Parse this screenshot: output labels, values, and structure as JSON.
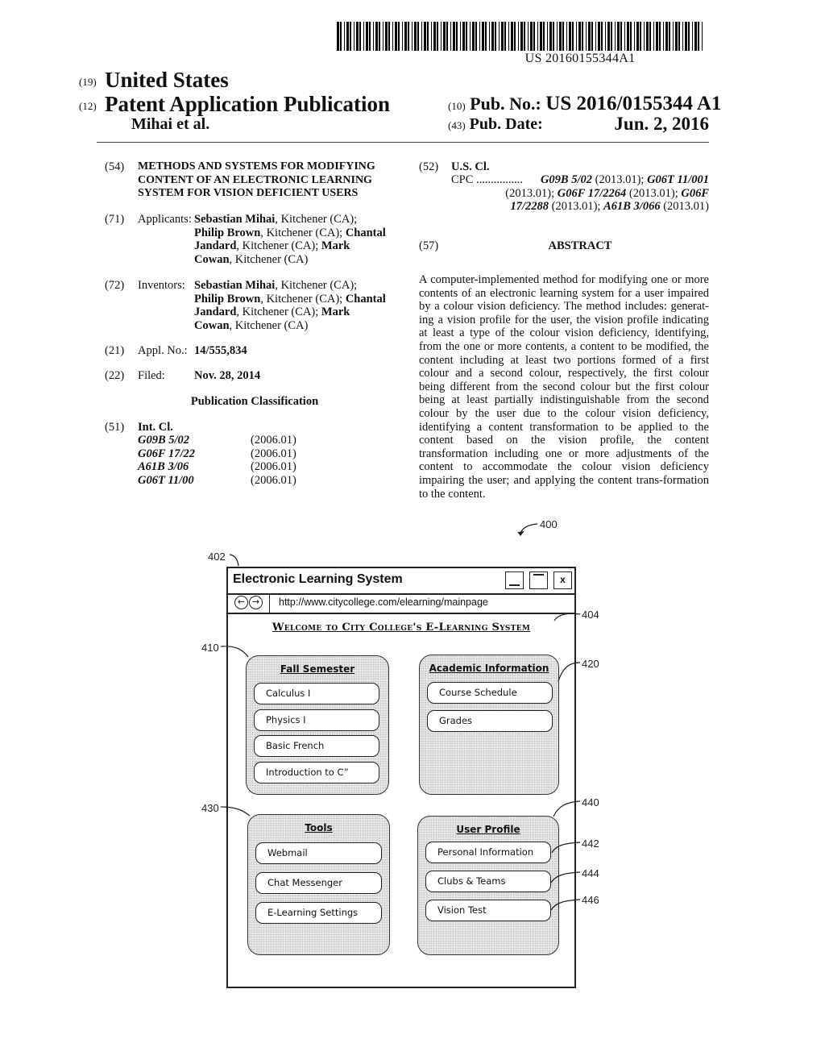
{
  "barcode": {
    "number": "US 20160155344A1"
  },
  "header": {
    "code_country": "(19)",
    "country": "United States",
    "code_type": "(12)",
    "doc_type": "Patent Application Publication",
    "authors": "Mihai et al.",
    "code_pubno": "(10)",
    "pubno_label": "Pub. No.:",
    "pubno_value": "US 2016/0155344 A1",
    "code_pubdate": "(43)",
    "pubdate_label": "Pub. Date:",
    "pubdate_value": "Jun. 2, 2016"
  },
  "left": {
    "title": {
      "code": "(54)",
      "text": "METHODS AND SYSTEMS FOR MODIFYING CONTENT OF AN ELECTRONIC LEARNING SYSTEM FOR VISION DEFICIENT USERS"
    },
    "applicants": {
      "code": "(71)",
      "label": "Applicants:",
      "lines": [
        [
          {
            "b": "Sebastian Mihai"
          },
          {
            "t": ", Kitchener (CA);"
          }
        ],
        [
          {
            "b": "Philip Brown"
          },
          {
            "t": ", Kitchener (CA); "
          },
          {
            "b": "Chantal"
          }
        ],
        [
          {
            "b": "Jandard"
          },
          {
            "t": ", Kitchener (CA); "
          },
          {
            "b": "Mark"
          }
        ],
        [
          {
            "b": "Cowan"
          },
          {
            "t": ", Kitchener (CA)"
          }
        ]
      ]
    },
    "inventors": {
      "code": "(72)",
      "label": "Inventors:",
      "lines": [
        [
          {
            "b": "Sebastian Mihai"
          },
          {
            "t": ", Kitchener (CA);"
          }
        ],
        [
          {
            "b": "Philip Brown"
          },
          {
            "t": ", Kitchener (CA); "
          },
          {
            "b": "Chantal"
          }
        ],
        [
          {
            "b": "Jandard"
          },
          {
            "t": ", Kitchener (CA); "
          },
          {
            "b": "Mark"
          }
        ],
        [
          {
            "b": "Cowan"
          },
          {
            "t": ", Kitchener (CA)"
          }
        ]
      ]
    },
    "appl": {
      "code": "(21)",
      "label": "Appl. No.:",
      "value": "14/555,834"
    },
    "filed": {
      "code": "(22)",
      "label": "Filed:",
      "value": "Nov. 28, 2014"
    },
    "pub_class_heading": "Publication Classification",
    "int_cl": {
      "code": "(51)",
      "label": "Int. Cl.",
      "rows": [
        {
          "class": "G09B 5/02",
          "version": "(2006.01)"
        },
        {
          "class": "G06F 17/22",
          "version": "(2006.01)"
        },
        {
          "class": "A61B 3/06",
          "version": "(2006.01)"
        },
        {
          "class": "G06T 11/00",
          "version": "(2006.01)"
        }
      ]
    }
  },
  "right": {
    "us_cl": {
      "code": "(52)",
      "label": "U.S. Cl.",
      "cpc_label": "CPC",
      "cpc_dots": "................",
      "lines": [
        [
          {
            "i": "G09B 5/02"
          },
          {
            "t": " (2013.01); "
          },
          {
            "i": "G06T 11/001"
          }
        ],
        [
          {
            "t": "(2013.01); "
          },
          {
            "i": "G06F 17/2264"
          },
          {
            "t": " (2013.01); "
          },
          {
            "i": "G06F"
          }
        ],
        [
          {
            "i": "17/2288"
          },
          {
            "t": " (2013.01); "
          },
          {
            "i": "A61B 3/066"
          },
          {
            "t": " (2013.01)"
          }
        ]
      ]
    },
    "abstract": {
      "code": "(57)",
      "heading": "ABSTRACT",
      "text": "A computer-implemented method for modifying one or more contents of an electronic learning system for a user impaired by a colour vision deficiency. The method includes: generat-ing a vision profile for the user, the vision profile indicating at least a type of the colour vision deficiency, identifying, from the one or more contents, a content to be modified, the content including at least two portions formed of a first colour and a second colour, respectively, the first colour being different from the second colour but the first colour being at least partially indistinguishable from the second colour by the user due to the colour vision deficiency, identifying a content transformation to be applied to the content based on the vision profile, the content transformation including one or more adjustments of the content to accommodate the colour vision deficiency impairing the user; and applying the content trans-formation to the content."
    }
  },
  "figure": {
    "refs": {
      "fig": "400",
      "window": "402",
      "welcome": "404",
      "panel1": "410",
      "panel2": "420",
      "panel3": "430",
      "panel4": "440",
      "item_personal": "442",
      "item_clubs": "444",
      "item_vision": "446"
    },
    "window": {
      "title": "Electronic Learning System",
      "min_icon": "minimize-icon",
      "max_icon": "maximize-icon",
      "close_label": "x",
      "back_icon": "⊖",
      "forward_icon": "⊖",
      "url": "http://www.citycollege.com/elearning/mainpage",
      "welcome": "Welcome to City College's E-Learning System"
    },
    "panels": [
      {
        "title": "Fall Semester",
        "items": [
          "Calculus I",
          "Physics I",
          "Basic French",
          "Introduction to C”"
        ]
      },
      {
        "title": "Academic Information",
        "items": [
          "Course Schedule",
          "Grades"
        ]
      },
      {
        "title": "Tools",
        "items": [
          "Webmail",
          "Chat Messenger",
          "E-Learning Settings"
        ]
      },
      {
        "title": "User Profile",
        "items": [
          "Personal Information",
          "Clubs & Teams",
          "Vision Test"
        ]
      }
    ]
  }
}
